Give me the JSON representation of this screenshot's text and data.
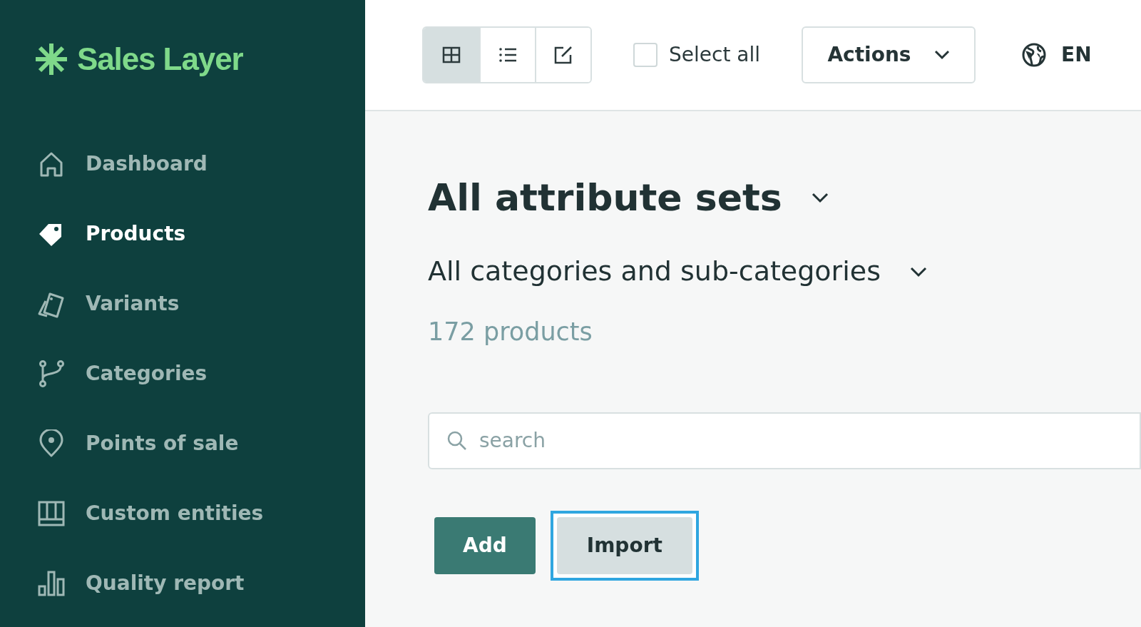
{
  "sidebar": {
    "logo": "Sales Layer",
    "items": [
      {
        "kind": "home",
        "label": "Dashboard",
        "selected": false
      },
      {
        "kind": "tag",
        "label": "Products",
        "selected": true
      },
      {
        "kind": "variants",
        "label": "Variants",
        "selected": false
      },
      {
        "kind": "branch",
        "label": "Categories",
        "selected": false
      },
      {
        "kind": "pin",
        "label": "Points of sale",
        "selected": false
      },
      {
        "kind": "entities",
        "label": "Custom entities",
        "selected": false
      },
      {
        "kind": "chart",
        "label": "Quality report",
        "selected": false
      }
    ]
  },
  "toolbar": {
    "views": [
      {
        "kind": "grid",
        "selected": true
      },
      {
        "kind": "list",
        "selected": false
      },
      {
        "kind": "edit",
        "selected": false
      }
    ],
    "select_all": {
      "label": "Select all",
      "checked": false
    },
    "actions": "Actions",
    "language": "EN"
  },
  "main": {
    "title": "All attribute sets",
    "subtitle": "All categories and sub-categories",
    "count": "172 products",
    "search": {
      "placeholder": "search"
    },
    "buttons": [
      {
        "kind": "primary",
        "label": "Add",
        "focused": false
      },
      {
        "kind": "secondary",
        "label": "Import",
        "focused": true
      }
    ]
  }
}
